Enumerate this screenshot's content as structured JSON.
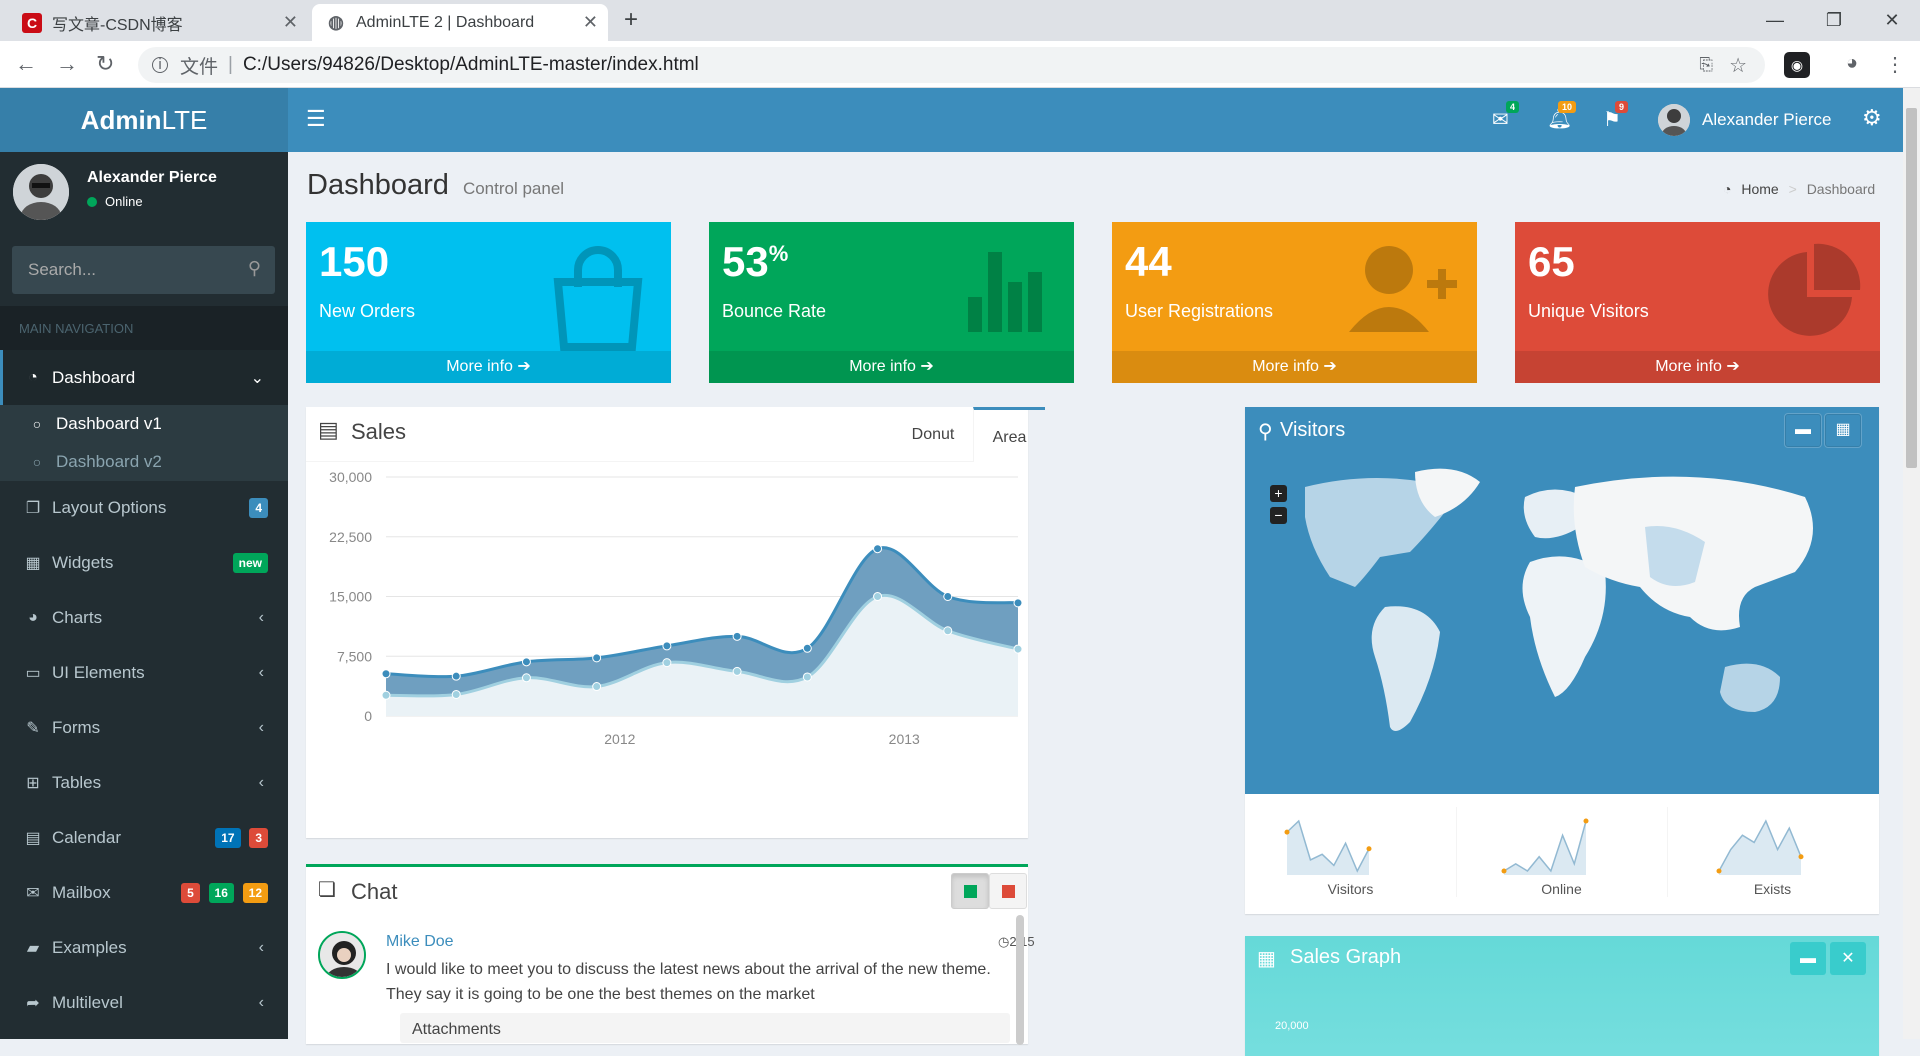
{
  "browser": {
    "tabs": [
      {
        "title": "写文章-CSDN博客",
        "icon_text": "C",
        "icon_color": "#ca0c16"
      },
      {
        "title": "AdminLTE 2 | Dashboard"
      }
    ],
    "file_label": "文件",
    "url": "C:/Users/94826/Desktop/AdminLTE-master/index.html"
  },
  "header": {
    "logo_bold": "Admin",
    "logo_light": "LTE",
    "mail_count": "4",
    "bell_count": "10",
    "flag_count": "9",
    "user_name": "Alexander Pierce"
  },
  "sidebar": {
    "user_name": "Alexander Pierce",
    "status": "Online",
    "search_placeholder": "Search...",
    "header": "MAIN NAVIGATION",
    "dashboard": "Dashboard",
    "sub": [
      "Dashboard v1",
      "Dashboard v2"
    ],
    "items": [
      {
        "label": "Layout Options",
        "icon": "files-icon"
      },
      {
        "label": "Widgets",
        "icon": "th-icon"
      },
      {
        "label": "Charts",
        "icon": "pie-chart-icon"
      },
      {
        "label": "UI Elements",
        "icon": "laptop-icon"
      },
      {
        "label": "Forms",
        "icon": "edit-icon"
      },
      {
        "label": "Tables",
        "icon": "table-icon"
      },
      {
        "label": "Calendar",
        "icon": "calendar-icon"
      },
      {
        "label": "Mailbox",
        "icon": "envelope-icon"
      },
      {
        "label": "Examples",
        "icon": "folder-icon"
      },
      {
        "label": "Multilevel",
        "icon": "share-icon"
      }
    ],
    "badges": {
      "layout": "4",
      "widgets": "new",
      "calendar": [
        "17",
        "3"
      ],
      "mailbox": [
        "5",
        "16",
        "12"
      ]
    }
  },
  "page": {
    "title": "Dashboard",
    "subtitle": "Control panel",
    "breadcrumb_home": "Home",
    "breadcrumb_current": "Dashboard"
  },
  "stats": [
    {
      "value": "150",
      "suffix": "",
      "label": "New Orders",
      "color": "#00c0ef"
    },
    {
      "value": "53",
      "suffix": "%",
      "label": "Bounce Rate",
      "color": "#00a65a"
    },
    {
      "value": "44",
      "suffix": "",
      "label": "User Registrations",
      "color": "#f39c12"
    },
    {
      "value": "65",
      "suffix": "",
      "label": "Unique Visitors",
      "color": "#dd4b39"
    }
  ],
  "more_info": "More info",
  "sales": {
    "title": "Sales",
    "tabs": [
      "Donut",
      "Area"
    ]
  },
  "chart_data": {
    "type": "area",
    "x_ticks": [
      "2012",
      "2013"
    ],
    "y_ticks": [
      "0",
      "7,500",
      "15,000",
      "22,500",
      "30,000"
    ],
    "ylim": [
      0,
      30000
    ],
    "series": [
      {
        "values": [
          5300,
          5000,
          6800,
          7300,
          8800,
          10000,
          8500,
          21000,
          15000,
          14200
        ]
      },
      {
        "values": [
          2600,
          2700,
          4800,
          3700,
          6700,
          5600,
          4900,
          15000,
          10700,
          8400
        ]
      }
    ]
  },
  "visitors": {
    "title": "Visitors",
    "sparklines": [
      {
        "label": "Visitors",
        "values": [
          8,
          10,
          3,
          4,
          2,
          6,
          1,
          5
        ]
      },
      {
        "label": "Online",
        "values": [
          2,
          3,
          2,
          4,
          2,
          7,
          3,
          9
        ]
      },
      {
        "label": "Exists",
        "values": [
          1,
          4,
          6,
          5,
          8,
          4,
          7,
          3
        ]
      }
    ]
  },
  "chat": {
    "title": "Chat",
    "name": "Mike Doe",
    "time": "2:15",
    "message": "I would like to meet you to discuss the latest news about the arrival of the new theme. They say it is going to be one the best themes on the market",
    "attachments_partial": "Attachments"
  },
  "sales_graph": {
    "title": "Sales Graph",
    "first_tick": "20,000"
  }
}
